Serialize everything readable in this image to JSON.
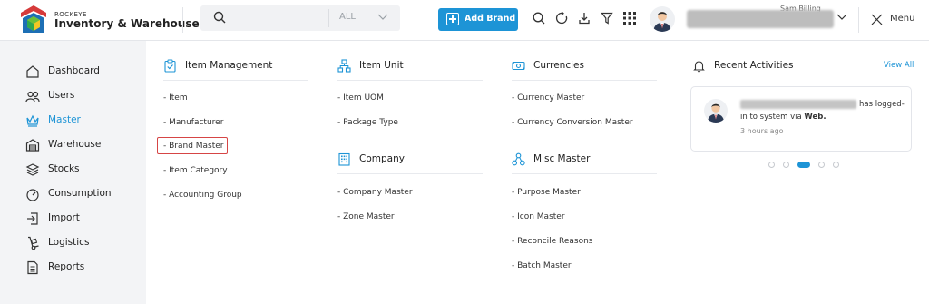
{
  "header": {
    "brand_small": "ROCKEYE",
    "brand_title": "Inventory & Warehouse",
    "search_placeholder": "",
    "search_filter": "ALL",
    "add_brand_label": "Add Brand",
    "user_name": "Sam Billing",
    "menu_label": "Menu"
  },
  "sidebar": {
    "items": [
      {
        "label": "Dashboard",
        "icon": "home-icon"
      },
      {
        "label": "Users",
        "icon": "users-icon"
      },
      {
        "label": "Master",
        "icon": "crown-icon",
        "active": true
      },
      {
        "label": "Warehouse",
        "icon": "warehouse-icon"
      },
      {
        "label": "Stocks",
        "icon": "stocks-icon"
      },
      {
        "label": "Consumption",
        "icon": "gauge-icon"
      },
      {
        "label": "Import",
        "icon": "import-icon"
      },
      {
        "label": "Logistics",
        "icon": "hand-truck-icon"
      },
      {
        "label": "Reports",
        "icon": "report-icon"
      }
    ]
  },
  "menu": {
    "item_management": {
      "title": "Item Management",
      "links": [
        "- Item",
        "- Manufacturer",
        "- Brand Master",
        "- Item Category",
        "- Accounting Group"
      ]
    },
    "item_unit": {
      "title": "Item Unit",
      "links": [
        "- Item UOM",
        "- Package Type"
      ]
    },
    "company": {
      "title": "Company",
      "links": [
        "- Company Master",
        "- Zone Master"
      ]
    },
    "currencies": {
      "title": "Currencies",
      "links": [
        "- Currency Master",
        "- Currency Conversion Master"
      ]
    },
    "misc_master": {
      "title": "Misc Master",
      "links": [
        "- Purpose Master",
        "- Icon Master",
        "- Reconcile Reasons",
        "- Batch Master"
      ]
    }
  },
  "activities": {
    "title": "Recent Activities",
    "view_all": "View All",
    "card": {
      "text_line1": "has logged-",
      "text_line2_prefix": "in to system via ",
      "text_line2_bold": "Web.",
      "time": "3 hours ago"
    },
    "dots_count": 5,
    "active_dot": 2
  },
  "colors": {
    "accent": "#1d94d6",
    "highlight": "#d64545"
  }
}
